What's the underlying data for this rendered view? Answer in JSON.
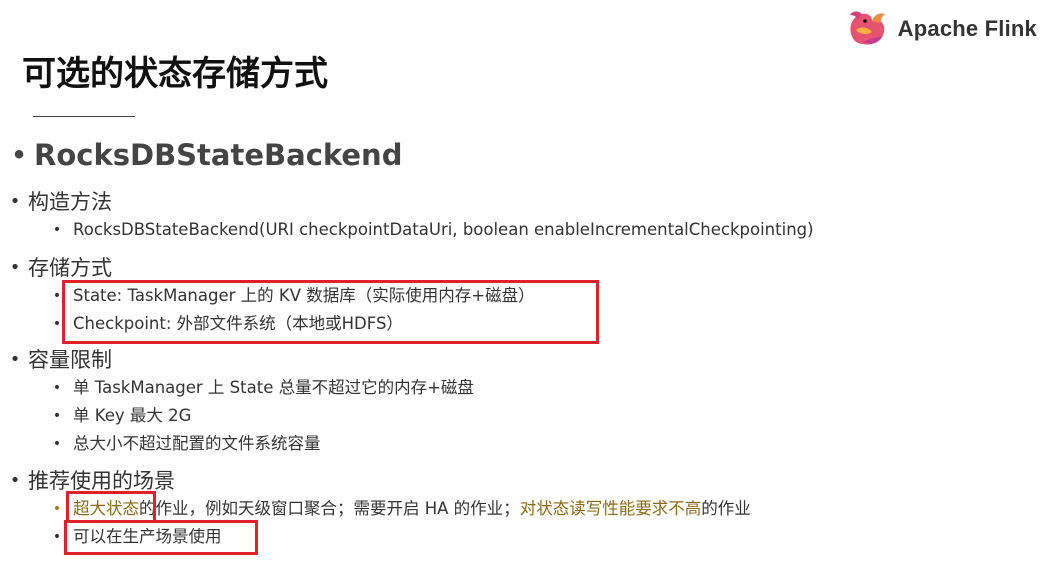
{
  "brand": {
    "name": "Apache Flink",
    "logo_icon": "squirrel-logo-icon"
  },
  "title": "可选的状态存储方式",
  "heading": "RocksDBStateBackend",
  "sections": {
    "construct": {
      "label": "构造方法",
      "items": [
        "RocksDBStateBackend(URI checkpointDataUri, boolean enableIncrementalCheckpointing)"
      ]
    },
    "storage": {
      "label": "存储方式",
      "items": [
        "State: TaskManager 上的 KV 数据库（实际使用内存+磁盘）",
        "Checkpoint: 外部文件系统（本地或HDFS）"
      ]
    },
    "capacity": {
      "label": "容量限制",
      "items": [
        "单 TaskManager 上 State 总量不超过它的内存+磁盘",
        "单 Key 最大 2G",
        "总大小不超过配置的文件系统容量"
      ]
    },
    "scenarios": {
      "label": "推荐使用的场景",
      "line1": {
        "part1": "超大状态",
        "part2": "的作业，例如天级窗口聚合；需要开启 HA 的作业；",
        "part3": "对状态读写性能要求不高",
        "part4": "的作业"
      },
      "line2": "可以在生产场景使用"
    }
  },
  "colors": {
    "highlight_box": "#e0202a",
    "emphasis_text": "#8c6a12"
  }
}
